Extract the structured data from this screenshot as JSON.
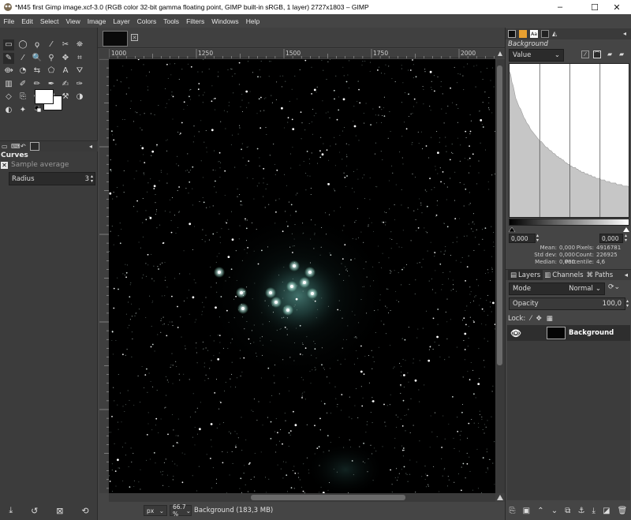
{
  "window": {
    "title": "*M45 first Gimp image.xcf-3.0 (RGB color 32-bit gamma floating point, GIMP built-in sRGB, 1 layer) 2727x1803 – GIMP",
    "controls": [
      "–",
      "☐",
      "✕"
    ]
  },
  "menu": [
    "File",
    "Edit",
    "Select",
    "View",
    "Image",
    "Layer",
    "Colors",
    "Tools",
    "Filters",
    "Windows",
    "Help"
  ],
  "toolbox": {
    "rows": [
      [
        "rect-select-icon",
        "ellipse-select-icon",
        "free-select-icon",
        "fuzzy-select-icon",
        "scissors-icon",
        "foreground-select-icon"
      ],
      [
        "paths-icon",
        "color-picker-icon",
        "zoom-icon",
        "measure-icon",
        "move-icon",
        "crop-icon"
      ],
      [
        "unified-transform-icon",
        "warp-transform-icon",
        "flip-icon",
        "cage-transform-icon",
        "text-icon",
        "bucket-fill-icon"
      ],
      [
        "gradient-icon",
        "paintbrush-icon",
        "pencil-icon",
        "airbrush-icon",
        "ink-icon",
        "mypaint-brush-icon"
      ],
      [
        "eraser-icon",
        "clone-icon",
        "heal-icon",
        "perspective-clone-icon",
        "smudge-icon",
        "dodge-burn-icon"
      ],
      [
        "convolve-icon",
        "blur-icon",
        "smudge-tool-icon"
      ]
    ],
    "glyphs": [
      [
        "▭",
        "◯",
        "ϙ",
        "⁄",
        "✂",
        "⛯"
      ],
      [
        "✎",
        "⁄",
        "🔍",
        "⚲",
        "✥",
        "⌗"
      ],
      [
        "⟴",
        "◔",
        "⇆",
        "⬠",
        "A",
        "⛛"
      ],
      [
        "▥",
        "✐",
        "✏",
        "✒",
        "✍",
        "✑"
      ],
      [
        "◇",
        "⎘",
        "✚",
        "▦",
        "⚒",
        "◑"
      ],
      [
        "◐",
        "✦",
        "✧"
      ]
    ]
  },
  "tool_options": {
    "title": "Curves",
    "sample_average_label": "Sample average",
    "radius_label": "Radius",
    "radius_value": "3"
  },
  "image_tab": {
    "close": "✕"
  },
  "hruler_ticks": [
    "1000",
    "1250",
    "1500",
    "1750",
    "2000"
  ],
  "status": {
    "unit": "px",
    "zoom": "66.7 %",
    "layer_info": "Background (183,3 MB)"
  },
  "histogram": {
    "layer_name": "Background",
    "channel": "Value",
    "range_min": "0,000",
    "range_max": "0,000",
    "mean_label": "Mean:",
    "mean_value": "0,000",
    "stddev_label": "Std dev:",
    "stddev_value": "0,000",
    "median_label": "Median:",
    "median_value": "0,000",
    "pixels_label": "Pixels:",
    "pixels_value": "4916781",
    "count_label": "Count:",
    "count_value": "226925",
    "percentile_label": "Percentile:",
    "percentile_value": "4,6",
    "curve": [
      0.95,
      0.93,
      0.88,
      0.86,
      0.82,
      0.78,
      0.76,
      0.74,
      0.72,
      0.71,
      0.69,
      0.67,
      0.65,
      0.64,
      0.62,
      0.61,
      0.6,
      0.58,
      0.57,
      0.56,
      0.55,
      0.54,
      0.53,
      0.52,
      0.51,
      0.5,
      0.5,
      0.49,
      0.48,
      0.47,
      0.46,
      0.46,
      0.45,
      0.44,
      0.44,
      0.43,
      0.42,
      0.42,
      0.41,
      0.4,
      0.4,
      0.39,
      0.39,
      0.38,
      0.38,
      0.37,
      0.36,
      0.36,
      0.35,
      0.35,
      0.34,
      0.34,
      0.33,
      0.33,
      0.33,
      0.32,
      0.32,
      0.31,
      0.31,
      0.3,
      0.3,
      0.3,
      0.29,
      0.29,
      0.29,
      0.28,
      0.28,
      0.28,
      0.27,
      0.27,
      0.27,
      0.26,
      0.26,
      0.26,
      0.26,
      0.25,
      0.25,
      0.25,
      0.25,
      0.24,
      0.24,
      0.24,
      0.24,
      0.23,
      0.23,
      0.23,
      0.23,
      0.23,
      0.22,
      0.22,
      0.22,
      0.22,
      0.22,
      0.21,
      0.21,
      0.21,
      0.21,
      0.21,
      0.2,
      0.2
    ]
  },
  "layers_panel": {
    "tabs": [
      "Layers",
      "Channels",
      "Paths"
    ],
    "mode_label": "Mode",
    "mode_value": "Normal",
    "opacity_label": "Opacity",
    "opacity_value": "100,0",
    "lock_label": "Lock:",
    "layer_name": "Background"
  },
  "colors": {
    "bg": "#454545",
    "panel": "#3c3c3c",
    "sky": "#000000",
    "nebula": "#3f6f68"
  }
}
